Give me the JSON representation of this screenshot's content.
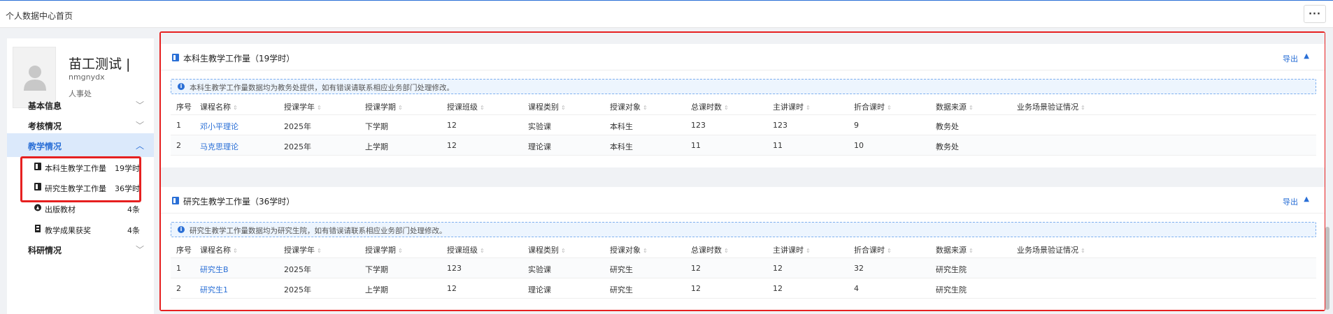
{
  "topbar": {
    "title": "个人数据中心首页",
    "more_label": "···"
  },
  "profile": {
    "name": "苗工测试 |",
    "uid": "nmgnydx",
    "dept": "人事处"
  },
  "sidebar": {
    "groups": [
      {
        "label": "基本信息",
        "chevron": "﹀"
      },
      {
        "label": "考核情况",
        "chevron": "﹀"
      },
      {
        "label": "教学情况",
        "chevron": "︿"
      },
      {
        "label": "科研情况",
        "chevron": "﹀"
      }
    ],
    "sub_items": [
      {
        "label": "本科生教学工作量",
        "count": "19学时",
        "icon": "book-icon"
      },
      {
        "label": "研究生教学工作量",
        "count": "36学时",
        "icon": "book-icon"
      },
      {
        "label": "出版教材",
        "count": "4条",
        "icon": "compass-icon"
      },
      {
        "label": "教学成果获奖",
        "count": "4条",
        "icon": "trophy-icon"
      }
    ]
  },
  "columns": [
    "序号",
    "课程名称",
    "授课学年",
    "授课学期",
    "授课班级",
    "课程类别",
    "授课对象",
    "总课时数",
    "主讲课时",
    "折合课时",
    "数据来源",
    "业务场景验证情况"
  ],
  "undergrad": {
    "title": "本科生教学工作量（19学时）",
    "export_label": "导出",
    "caret": "▲",
    "notice": "本科生教学工作量数据均为教务处提供，如有错误请联系相应业务部门处理修改。",
    "rows": [
      [
        "1",
        "邓小平理论",
        "2025年",
        "下学期",
        "12",
        "实验课",
        "本科生",
        "123",
        "123",
        "9",
        "教务处",
        ""
      ],
      [
        "2",
        "马克思理论",
        "2025年",
        "上学期",
        "12",
        "理论课",
        "本科生",
        "11",
        "11",
        "10",
        "教务处",
        ""
      ]
    ]
  },
  "graduate": {
    "title": "研究生教学工作量（36学时）",
    "export_label": "导出",
    "caret": "▲",
    "notice": "研究生教学工作量数据均为研究生院，如有错误请联系相应业务部门处理修改。",
    "rows": [
      [
        "1",
        "研究生B",
        "2025年",
        "下学期",
        "123",
        "实验课",
        "研究生",
        "12",
        "12",
        "32",
        "研究生院",
        ""
      ],
      [
        "2",
        "研究生1",
        "2025年",
        "上学期",
        "12",
        "理论课",
        "研究生",
        "12",
        "12",
        "4",
        "研究生院",
        ""
      ]
    ]
  },
  "colors": {
    "accent": "#2a6fd6",
    "highlight_border": "#e62020",
    "active_bg": "#dbe9fb"
  }
}
